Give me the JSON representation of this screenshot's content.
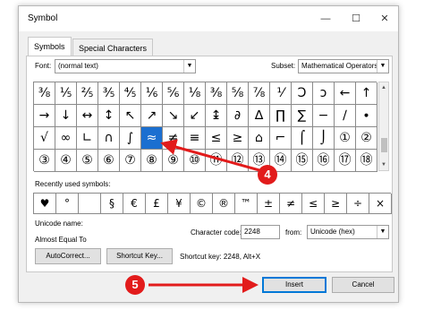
{
  "window": {
    "title": "Symbol",
    "minimize_glyph": "—",
    "maximize_glyph": "☐",
    "close_glyph": "✕"
  },
  "tabs": [
    {
      "label": "Symbols",
      "active": true
    },
    {
      "label": "Special Characters",
      "active": false
    }
  ],
  "font": {
    "label": "Font:",
    "value": "(normal text)"
  },
  "subset": {
    "label": "Subset:",
    "value": "Mathematical Operators"
  },
  "grid": [
    [
      "⅜",
      "⅕",
      "⅖",
      "⅗",
      "⅘",
      "⅙",
      "⅚",
      "⅛",
      "⅜",
      "⅝",
      "⅞",
      "⅟",
      "Ↄ",
      "ↄ",
      "←",
      "↑"
    ],
    [
      "→",
      "↓",
      "↔",
      "↕",
      "↖",
      "↗",
      "↘",
      "↙",
      "↨",
      "∂",
      "∆",
      "∏",
      "∑",
      "−",
      "∕",
      "∙"
    ],
    [
      "√",
      "∞",
      "∟",
      "∩",
      "∫",
      "≈",
      "≠",
      "≡",
      "≤",
      "≥",
      "⌂",
      "⌐",
      "⌠",
      "⌡",
      "①",
      "②"
    ],
    [
      "③",
      "④",
      "⑤",
      "⑥",
      "⑦",
      "⑧",
      "⑨",
      "⑩",
      "⑪",
      "⑫",
      "⑬",
      "⑭",
      "⑮",
      "⑯",
      "⑰",
      "⑱"
    ]
  ],
  "selected": {
    "row": 2,
    "col": 5
  },
  "recent": {
    "label": "Recently used symbols:",
    "symbols": [
      "♥",
      "°",
      "",
      "§",
      "€",
      "£",
      "¥",
      "©",
      "®",
      "™",
      "±",
      "≠",
      "≤",
      "≥",
      "÷",
      "×"
    ]
  },
  "unicode": {
    "name_label": "Unicode name:",
    "name_value": "Almost Equal To"
  },
  "char_code": {
    "label": "Character code:",
    "value": "2248"
  },
  "from": {
    "label": "from:",
    "value": "Unicode (hex)"
  },
  "buttons": {
    "autocorrect": "AutoCorrect...",
    "shortcut_key": "Shortcut Key...",
    "insert": "Insert",
    "cancel": "Cancel"
  },
  "shortcut_text": "Shortcut key: 2248, Alt+X",
  "scroll": {
    "up": "▲",
    "down": "▼"
  },
  "annotations": [
    {
      "number": "4",
      "color": "#e21b1b"
    },
    {
      "number": "5",
      "color": "#e21b1b"
    }
  ],
  "colors": {
    "selection": "#1b6fd0",
    "annotation": "#e21b1b"
  }
}
